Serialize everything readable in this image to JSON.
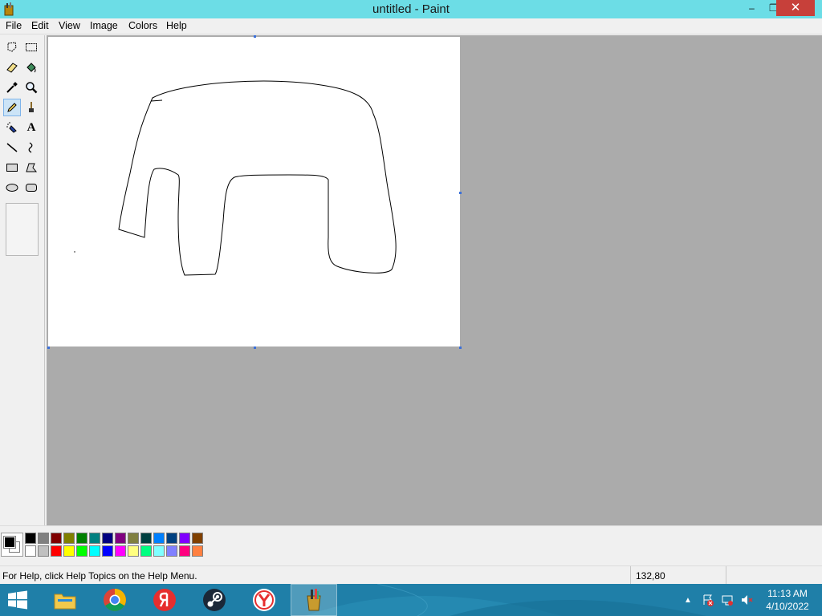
{
  "window": {
    "title": "untitled - Paint",
    "controls": {
      "minimize": "–",
      "restore": "❐",
      "close": "✕"
    }
  },
  "menu": {
    "items": [
      "File",
      "Edit",
      "View",
      "Image",
      "Colors",
      "Help"
    ]
  },
  "toolbox": {
    "tools": [
      {
        "name": "free-form-select-icon"
      },
      {
        "name": "rect-select-icon"
      },
      {
        "name": "eraser-icon"
      },
      {
        "name": "fill-bucket-icon"
      },
      {
        "name": "color-picker-icon"
      },
      {
        "name": "magnifier-icon"
      },
      {
        "name": "pencil-icon",
        "selected": true
      },
      {
        "name": "brush-icon"
      },
      {
        "name": "airbrush-icon"
      },
      {
        "name": "text-icon",
        "label": "A"
      },
      {
        "name": "line-icon"
      },
      {
        "name": "curve-icon"
      },
      {
        "name": "rectangle-icon"
      },
      {
        "name": "polygon-icon"
      },
      {
        "name": "ellipse-icon"
      },
      {
        "name": "rounded-rect-icon"
      }
    ]
  },
  "palette": {
    "foreground": "#000000",
    "background": "#ffffff",
    "top_row": [
      "#000000",
      "#808080",
      "#800000",
      "#808000",
      "#008000",
      "#008080",
      "#000080",
      "#800080",
      "#808040",
      "#004040",
      "#0080ff",
      "#004080",
      "#8000ff",
      "#804000"
    ],
    "bottom_row": [
      "#ffffff",
      "#c0c0c0",
      "#ff0000",
      "#ffff00",
      "#00ff00",
      "#00ffff",
      "#0000ff",
      "#ff00ff",
      "#ffff80",
      "#00ff80",
      "#80ffff",
      "#8080ff",
      "#ff0080",
      "#ff8040"
    ]
  },
  "status": {
    "help_text": "For Help, click Help Topics on the Help Menu.",
    "coordinates": "132,80"
  },
  "taskbar": {
    "apps": [
      "file-explorer",
      "chrome",
      "yandex-browser",
      "steam",
      "yandex-browser-alt",
      "paint"
    ],
    "clock_time": "11:13 AM",
    "clock_date": "4/10/2022"
  },
  "colors": {
    "titlebar": "#6cdde6",
    "workspace": "#ababab",
    "taskbar": "#1f7fa8"
  }
}
